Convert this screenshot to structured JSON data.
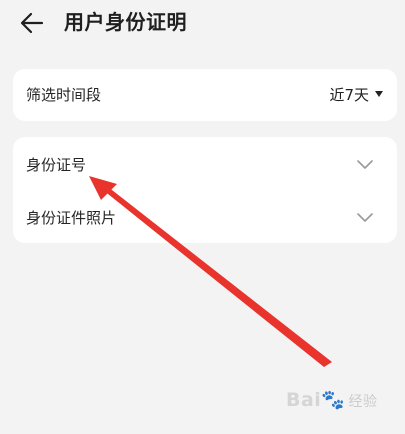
{
  "header": {
    "title": "用户身份证明",
    "back_icon": "arrow-left-icon"
  },
  "filter": {
    "label": "筛选时间段",
    "value": "近7天",
    "icon": "caret-down-icon"
  },
  "id_section": {
    "items": [
      {
        "label": "身份证号",
        "icon": "chevron-down-icon"
      },
      {
        "label": "身份证件照片",
        "icon": "chevron-down-icon"
      }
    ]
  },
  "annotation": {
    "arrow_color": "#e8342c"
  },
  "watermark": {
    "brand": "Bai",
    "paw": "🐾",
    "suffix": "经验"
  },
  "colors": {
    "background": "#f3f3f3",
    "card": "#ffffff",
    "text": "#1f1f1f"
  }
}
